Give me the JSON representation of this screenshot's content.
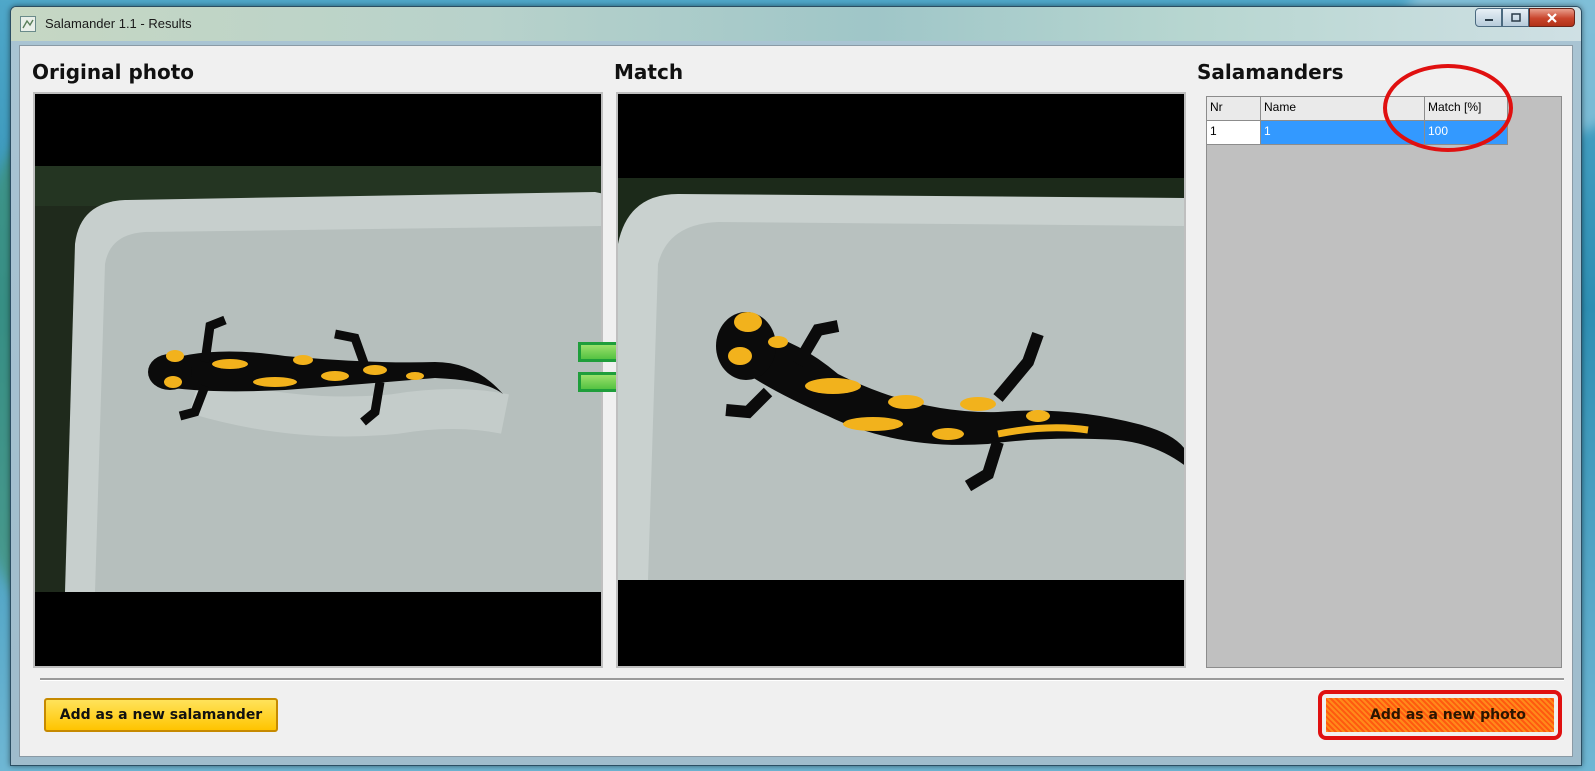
{
  "window": {
    "title": "Salamander 1.1 - Results",
    "caption_buttons": [
      "minimize-icon",
      "maximize-icon",
      "close-icon"
    ]
  },
  "panels": {
    "original_title": "Original photo",
    "match_title": "Match",
    "salamanders_title": "Salamanders"
  },
  "table": {
    "columns": [
      "Nr",
      "Name",
      "Match [%]"
    ],
    "rows": [
      {
        "nr": "1",
        "name": "1",
        "match": "100",
        "selected": true
      }
    ]
  },
  "buttons": {
    "add_new_salamander": "Add as a new salamander",
    "add_new_photo": "Add as a new photo"
  },
  "colors": {
    "accent_yellow": "#ffc400",
    "accent_orange": "#ff6a10",
    "selection_blue": "#3399ff",
    "annotation_red": "#e01010",
    "equals_green": "#55c342"
  },
  "icons": {
    "equals": "equals-icon",
    "app": "salamander-app-icon"
  }
}
